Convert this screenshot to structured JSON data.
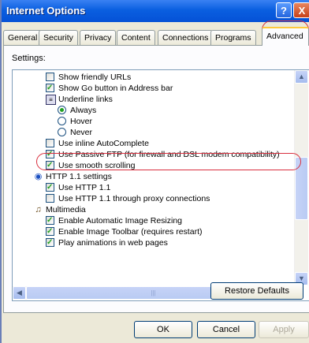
{
  "window": {
    "title": "Internet Options"
  },
  "titlebar_buttons": {
    "help": "?",
    "close": "X"
  },
  "tabs": [
    {
      "label": "General"
    },
    {
      "label": "Security"
    },
    {
      "label": "Privacy"
    },
    {
      "label": "Content"
    },
    {
      "label": "Connections"
    },
    {
      "label": "Programs"
    },
    {
      "label": "Advanced",
      "active": true
    }
  ],
  "settings_label": "Settings:",
  "settings_list": [
    {
      "type": "checkbox",
      "checked": false,
      "label": "Show friendly URLs"
    },
    {
      "type": "checkbox",
      "checked": true,
      "label": "Show Go button in Address bar"
    },
    {
      "type": "group",
      "icon": "list-icon",
      "label": "Underline links"
    },
    {
      "type": "radio",
      "checked": true,
      "label": "Always"
    },
    {
      "type": "radio",
      "checked": false,
      "label": "Hover"
    },
    {
      "type": "radio",
      "checked": false,
      "label": "Never"
    },
    {
      "type": "checkbox",
      "checked": false,
      "label": "Use inline AutoComplete"
    },
    {
      "type": "checkbox",
      "checked": true,
      "label": "Use Passive FTP (for firewall and DSL modem compatibility)"
    },
    {
      "type": "checkbox",
      "checked": true,
      "label": "Use smooth scrolling"
    },
    {
      "type": "group",
      "icon": "globe-icon",
      "label": "HTTP 1.1 settings"
    },
    {
      "type": "checkbox",
      "checked": true,
      "label": "Use HTTP 1.1"
    },
    {
      "type": "checkbox",
      "checked": false,
      "label": "Use HTTP 1.1 through proxy connections"
    },
    {
      "type": "group",
      "icon": "multimedia-icon",
      "label": "Multimedia"
    },
    {
      "type": "checkbox",
      "checked": true,
      "label": "Enable Automatic Image Resizing"
    },
    {
      "type": "checkbox",
      "checked": true,
      "label": "Enable Image Toolbar (requires restart)"
    },
    {
      "type": "checkbox",
      "checked": true,
      "label": "Play animations in web pages"
    }
  ],
  "restore_label": "Restore Defaults",
  "buttons": {
    "ok": "OK",
    "cancel": "Cancel",
    "apply": "Apply"
  },
  "annotation_color": "#d9303f"
}
